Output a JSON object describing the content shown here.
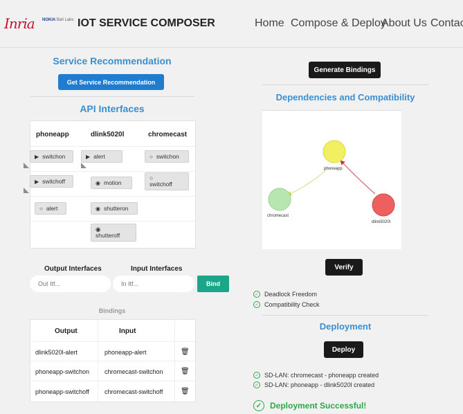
{
  "header": {
    "logo_inria": "Inria",
    "logo_nokia": "NOKIA",
    "logo_nokia_sub": "Bell Labs",
    "title": "IOT SERVICE COMPOSER",
    "nav": [
      "Home",
      "Compose & Deploy",
      "About Us",
      "Contact"
    ]
  },
  "recommendation": {
    "title": "Service Recommendation",
    "button": "Get Service Recommendation"
  },
  "api": {
    "title": "API Interfaces",
    "columns": [
      "phoneapp",
      "dlink5020l",
      "chromecast"
    ],
    "phoneapp": [
      "switchon",
      "switchoff",
      "alert"
    ],
    "dlink": [
      "alert",
      "motion",
      "shutteron",
      "shutteroff"
    ],
    "chromecast": [
      "switchon",
      "switchoff"
    ]
  },
  "binding_form": {
    "output_label": "Output Interfaces",
    "input_label": "Input Interfaces",
    "output_placeholder": "Out Itf...",
    "input_placeholder": "In Itf...",
    "bind_button": "Bind"
  },
  "bindings": {
    "title": "Bindings",
    "headers": [
      "Output",
      "Input"
    ],
    "rows": [
      [
        "dlink5020l-alert",
        "phoneapp-alert"
      ],
      [
        "phoneapp-switchon",
        "chromecast-switchon"
      ],
      [
        "phoneapp-switchoff",
        "chromecast-switchoff"
      ]
    ]
  },
  "right": {
    "generate_button": "Generate Bindings",
    "deps_title": "Dependencies and Compatibility",
    "graph_nodes": [
      {
        "label": "phoneapp",
        "color": "#f0f060"
      },
      {
        "label": "chromecast",
        "color": "#b8e6b0"
      },
      {
        "label": "dlink5020l",
        "color": "#ee6060"
      }
    ],
    "verify_button": "Verify",
    "checks": [
      "Deadlock Freedom",
      "Compatibility Check"
    ],
    "deploy_title": "Deployment",
    "deploy_button": "Deploy",
    "deploy_logs": [
      "SD-LAN: chromecast - phoneapp created",
      "SD-LAN: phoneapp - dlink5020l created"
    ],
    "success": "Deployment Successful!"
  },
  "colors": {
    "accent_blue": "#1f7ccf",
    "title_blue": "#3a8fd1",
    "bind_green": "#1ca689",
    "success_green": "#2aa84a"
  }
}
